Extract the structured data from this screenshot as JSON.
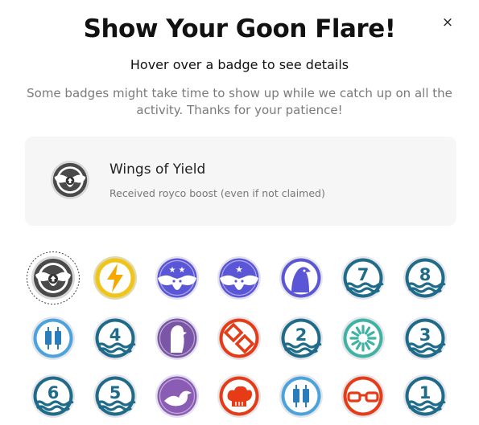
{
  "modal": {
    "title": "Show Your Goon Flare!",
    "subtitle": "Hover over a badge to see details",
    "note": "Some badges might take time to show up while we catch up on all the activity. Thanks for your patience!",
    "close_label": "×"
  },
  "selected_badge": {
    "name": "Wings of Yield",
    "description": "Received royco boost (even if not claimed)",
    "icon": "wings-boost-icon"
  },
  "badges": [
    {
      "id": "wings-of-yield",
      "icon": "wings-boost-icon",
      "color": "#4a4a4a",
      "selected": true
    },
    {
      "id": "lightning",
      "icon": "lightning-icon",
      "color": "#f1c419"
    },
    {
      "id": "wings-two-stars",
      "icon": "wings-two-stars-icon",
      "color": "#5a56d6"
    },
    {
      "id": "wings-one-star",
      "icon": "wings-one-star-icon",
      "color": "#5a56d6"
    },
    {
      "id": "eagle",
      "icon": "eagle-head-icon",
      "color": "#5a56d6"
    },
    {
      "id": "wave-7",
      "icon": "wave-number-icon",
      "number": "7",
      "color": "#1f6b8a"
    },
    {
      "id": "wave-8",
      "icon": "wave-number-icon",
      "number": "8",
      "color": "#1f6b8a"
    },
    {
      "id": "candles-blue",
      "icon": "candlestick-icon",
      "color": "#4ba3dd"
    },
    {
      "id": "wave-4",
      "icon": "wave-number-icon",
      "number": "4",
      "color": "#1f6b8a"
    },
    {
      "id": "bird-silhouette",
      "icon": "bird-silhouette-icon",
      "color": "#7b56a6"
    },
    {
      "id": "diamond-swap",
      "icon": "diamond-swap-icon",
      "color": "#e63b16"
    },
    {
      "id": "wave-2",
      "icon": "wave-number-icon",
      "number": "2",
      "color": "#1f6b8a"
    },
    {
      "id": "sunburst",
      "icon": "sunburst-icon",
      "color": "#3fb3a3"
    },
    {
      "id": "wave-3",
      "icon": "wave-number-icon",
      "number": "3",
      "color": "#1f6b8a"
    },
    {
      "id": "wave-6",
      "icon": "wave-number-icon",
      "number": "6",
      "color": "#1f6b8a"
    },
    {
      "id": "wave-5",
      "icon": "wave-number-icon",
      "number": "5",
      "color": "#1f6b8a"
    },
    {
      "id": "dove",
      "icon": "dove-icon",
      "color": "#8a5cb4"
    },
    {
      "id": "chef-hat",
      "icon": "chef-hat-icon",
      "color": "#e63b16"
    },
    {
      "id": "candle-single",
      "icon": "candlestick-icon",
      "color": "#4ba3dd"
    },
    {
      "id": "glasses",
      "icon": "glasses-icon",
      "color": "#e63b16"
    },
    {
      "id": "wave-1",
      "icon": "wave-number-icon",
      "number": "1",
      "color": "#1f6b8a"
    }
  ]
}
